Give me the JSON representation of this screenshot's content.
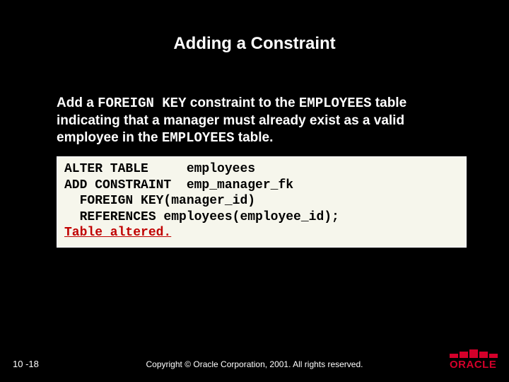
{
  "title": "Adding a Constraint",
  "body": {
    "pre1": "Add a ",
    "mono1": "FOREIGN KEY",
    "mid1": " constraint to the ",
    "mono2": "EMPLOYEES",
    "post1": " table indicating that a manager must already exist as a valid employee in the ",
    "mono3": "EMPLOYEES",
    "tail": " table."
  },
  "code": {
    "line1": "ALTER TABLE     employees",
    "line2": "ADD CONSTRAINT  emp_manager_fk",
    "line3": "  FOREIGN KEY(manager_id)",
    "line4": "  REFERENCES employees(employee_id);",
    "result": "Table altered."
  },
  "footer": {
    "page": "10 -18",
    "copyright": "Copyright © Oracle Corporation, 2001. All rights reserved.",
    "logo_text": "ORACLE"
  }
}
